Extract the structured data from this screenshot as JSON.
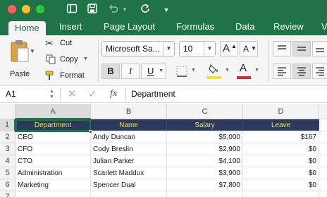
{
  "titlebar": {
    "icons": [
      "sidebar-icon",
      "save-icon",
      "undo-icon",
      "redo-icon",
      "customize-toolbar-icon"
    ]
  },
  "tabs": [
    {
      "label": "Home",
      "active": true
    },
    {
      "label": "Insert",
      "active": false
    },
    {
      "label": "Page Layout",
      "active": false
    },
    {
      "label": "Formulas",
      "active": false
    },
    {
      "label": "Data",
      "active": false
    },
    {
      "label": "Review",
      "active": false
    },
    {
      "label": "V",
      "active": false
    }
  ],
  "ribbon": {
    "paste_label": "Paste",
    "cut_label": "Cut",
    "copy_label": "Copy",
    "format_label": "Format",
    "font_name": "Microsoft Sa...",
    "font_size": "10",
    "bold": "B",
    "italic": "I",
    "underline": "U",
    "grow_font": "A",
    "shrink_font": "A",
    "highlight_color": "#f5e11a",
    "font_color": "#e0242b"
  },
  "formula_bar": {
    "name_box": "A1",
    "fx_label": "fx",
    "content": "Department"
  },
  "sheet": {
    "columns": [
      "A",
      "B",
      "C",
      "D"
    ],
    "rows": [
      "1",
      "2",
      "3",
      "4",
      "5",
      "6",
      "7"
    ],
    "header": [
      "Department",
      "Name",
      "Salary",
      "Leave"
    ],
    "data": [
      [
        "CEO",
        "Andy Duncan",
        "$5,000",
        "$167"
      ],
      [
        "CFO",
        "Cody Breslin",
        "$2,900",
        "$0"
      ],
      [
        "CTO",
        "Julian Parker",
        "$4,100",
        "$0"
      ],
      [
        "Administration",
        "Scarlett Maddux",
        "$3,900",
        "$0"
      ],
      [
        "Marketing",
        "Spencer Dual",
        "$7,800",
        "$0"
      ]
    ],
    "header_bg": "#2b3a5c",
    "header_fg": "#f2e03c",
    "selected_cell": "A1"
  },
  "accent": "#1f7346"
}
